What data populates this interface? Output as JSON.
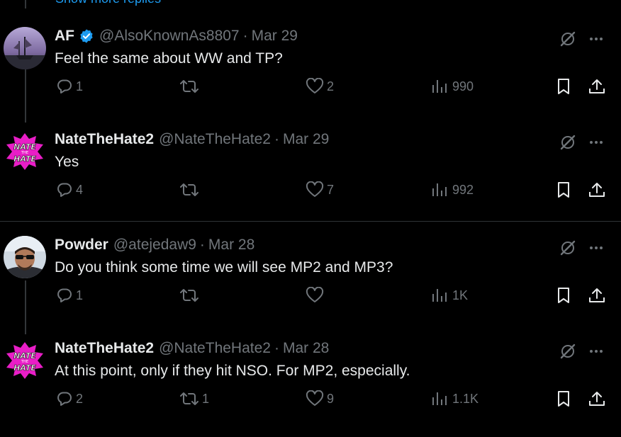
{
  "thread": {
    "show_more": "Show more replies"
  },
  "tweets": [
    {
      "display_name": "AF",
      "verified": true,
      "handle": "@AlsoKnownAs8807",
      "separator": "·",
      "date": "Mar 29",
      "text": "Feel the same about WW and TP?",
      "replies": "1",
      "retweets": "",
      "likes": "2",
      "views": "990",
      "avatar": "ship-painting-avatar"
    },
    {
      "display_name": "NateTheHate2",
      "verified": false,
      "handle": "@NateTheHate2",
      "separator": "·",
      "date": "Mar 29",
      "text": "Yes",
      "replies": "4",
      "retweets": "",
      "likes": "7",
      "views": "992",
      "avatar": "nate-the-hate-logo-avatar"
    },
    {
      "display_name": "Powder",
      "verified": false,
      "handle": "@atejedaw9",
      "separator": "·",
      "date": "Mar 28",
      "text": "Do you think some time we will see MP2 and MP3?",
      "replies": "1",
      "retweets": "",
      "likes": "",
      "views": "1K",
      "avatar": "man-with-sunglasses-photo-avatar"
    },
    {
      "display_name": "NateTheHate2",
      "verified": false,
      "handle": "@NateTheHate2",
      "separator": "·",
      "date": "Mar 28",
      "text": "At this point, only if they hit NSO. For MP2, especially.",
      "replies": "2",
      "retweets": "1",
      "likes": "9",
      "views": "1.1K",
      "avatar": "nate-the-hate-logo-avatar"
    }
  ],
  "colors": {
    "background": "#000000",
    "text": "#e7e9ea",
    "secondary": "#71767b",
    "accent": "#1d9bf0",
    "divider": "#2f3336"
  },
  "icons": {
    "reply": "reply-bubble-icon",
    "retweet": "retweet-icon",
    "like": "heart-icon",
    "views": "views-bar-chart-icon",
    "bookmark": "bookmark-icon",
    "share": "share-upload-icon",
    "grok": "grok-slash-icon",
    "more": "more-dots-icon"
  }
}
